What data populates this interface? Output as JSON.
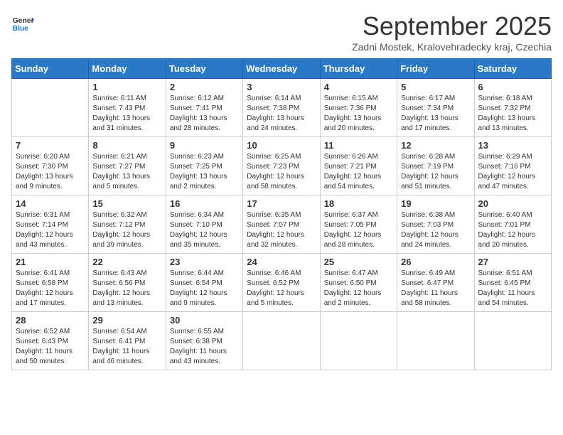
{
  "logo": {
    "general": "General",
    "blue": "Blue"
  },
  "title": "September 2025",
  "subtitle": "Zadni Mostek, Kralovehradecky kraj, Czechia",
  "weekdays": [
    "Sunday",
    "Monday",
    "Tuesday",
    "Wednesday",
    "Thursday",
    "Friday",
    "Saturday"
  ],
  "weeks": [
    [
      {
        "day": "",
        "sunrise": "",
        "sunset": "",
        "daylight": ""
      },
      {
        "day": "1",
        "sunrise": "Sunrise: 6:11 AM",
        "sunset": "Sunset: 7:43 PM",
        "daylight": "Daylight: 13 hours and 31 minutes."
      },
      {
        "day": "2",
        "sunrise": "Sunrise: 6:12 AM",
        "sunset": "Sunset: 7:41 PM",
        "daylight": "Daylight: 13 hours and 28 minutes."
      },
      {
        "day": "3",
        "sunrise": "Sunrise: 6:14 AM",
        "sunset": "Sunset: 7:38 PM",
        "daylight": "Daylight: 13 hours and 24 minutes."
      },
      {
        "day": "4",
        "sunrise": "Sunrise: 6:15 AM",
        "sunset": "Sunset: 7:36 PM",
        "daylight": "Daylight: 13 hours and 20 minutes."
      },
      {
        "day": "5",
        "sunrise": "Sunrise: 6:17 AM",
        "sunset": "Sunset: 7:34 PM",
        "daylight": "Daylight: 13 hours and 17 minutes."
      },
      {
        "day": "6",
        "sunrise": "Sunrise: 6:18 AM",
        "sunset": "Sunset: 7:32 PM",
        "daylight": "Daylight: 13 hours and 13 minutes."
      }
    ],
    [
      {
        "day": "7",
        "sunrise": "Sunrise: 6:20 AM",
        "sunset": "Sunset: 7:30 PM",
        "daylight": "Daylight: 13 hours and 9 minutes."
      },
      {
        "day": "8",
        "sunrise": "Sunrise: 6:21 AM",
        "sunset": "Sunset: 7:27 PM",
        "daylight": "Daylight: 13 hours and 5 minutes."
      },
      {
        "day": "9",
        "sunrise": "Sunrise: 6:23 AM",
        "sunset": "Sunset: 7:25 PM",
        "daylight": "Daylight: 13 hours and 2 minutes."
      },
      {
        "day": "10",
        "sunrise": "Sunrise: 6:25 AM",
        "sunset": "Sunset: 7:23 PM",
        "daylight": "Daylight: 12 hours and 58 minutes."
      },
      {
        "day": "11",
        "sunrise": "Sunrise: 6:26 AM",
        "sunset": "Sunset: 7:21 PM",
        "daylight": "Daylight: 12 hours and 54 minutes."
      },
      {
        "day": "12",
        "sunrise": "Sunrise: 6:28 AM",
        "sunset": "Sunset: 7:19 PM",
        "daylight": "Daylight: 12 hours and 51 minutes."
      },
      {
        "day": "13",
        "sunrise": "Sunrise: 6:29 AM",
        "sunset": "Sunset: 7:16 PM",
        "daylight": "Daylight: 12 hours and 47 minutes."
      }
    ],
    [
      {
        "day": "14",
        "sunrise": "Sunrise: 6:31 AM",
        "sunset": "Sunset: 7:14 PM",
        "daylight": "Daylight: 12 hours and 43 minutes."
      },
      {
        "day": "15",
        "sunrise": "Sunrise: 6:32 AM",
        "sunset": "Sunset: 7:12 PM",
        "daylight": "Daylight: 12 hours and 39 minutes."
      },
      {
        "day": "16",
        "sunrise": "Sunrise: 6:34 AM",
        "sunset": "Sunset: 7:10 PM",
        "daylight": "Daylight: 12 hours and 35 minutes."
      },
      {
        "day": "17",
        "sunrise": "Sunrise: 6:35 AM",
        "sunset": "Sunset: 7:07 PM",
        "daylight": "Daylight: 12 hours and 32 minutes."
      },
      {
        "day": "18",
        "sunrise": "Sunrise: 6:37 AM",
        "sunset": "Sunset: 7:05 PM",
        "daylight": "Daylight: 12 hours and 28 minutes."
      },
      {
        "day": "19",
        "sunrise": "Sunrise: 6:38 AM",
        "sunset": "Sunset: 7:03 PM",
        "daylight": "Daylight: 12 hours and 24 minutes."
      },
      {
        "day": "20",
        "sunrise": "Sunrise: 6:40 AM",
        "sunset": "Sunset: 7:01 PM",
        "daylight": "Daylight: 12 hours and 20 minutes."
      }
    ],
    [
      {
        "day": "21",
        "sunrise": "Sunrise: 6:41 AM",
        "sunset": "Sunset: 6:58 PM",
        "daylight": "Daylight: 12 hours and 17 minutes."
      },
      {
        "day": "22",
        "sunrise": "Sunrise: 6:43 AM",
        "sunset": "Sunset: 6:56 PM",
        "daylight": "Daylight: 12 hours and 13 minutes."
      },
      {
        "day": "23",
        "sunrise": "Sunrise: 6:44 AM",
        "sunset": "Sunset: 6:54 PM",
        "daylight": "Daylight: 12 hours and 9 minutes."
      },
      {
        "day": "24",
        "sunrise": "Sunrise: 6:46 AM",
        "sunset": "Sunset: 6:52 PM",
        "daylight": "Daylight: 12 hours and 5 minutes."
      },
      {
        "day": "25",
        "sunrise": "Sunrise: 6:47 AM",
        "sunset": "Sunset: 6:50 PM",
        "daylight": "Daylight: 12 hours and 2 minutes."
      },
      {
        "day": "26",
        "sunrise": "Sunrise: 6:49 AM",
        "sunset": "Sunset: 6:47 PM",
        "daylight": "Daylight: 11 hours and 58 minutes."
      },
      {
        "day": "27",
        "sunrise": "Sunrise: 6:51 AM",
        "sunset": "Sunset: 6:45 PM",
        "daylight": "Daylight: 11 hours and 54 minutes."
      }
    ],
    [
      {
        "day": "28",
        "sunrise": "Sunrise: 6:52 AM",
        "sunset": "Sunset: 6:43 PM",
        "daylight": "Daylight: 11 hours and 50 minutes."
      },
      {
        "day": "29",
        "sunrise": "Sunrise: 6:54 AM",
        "sunset": "Sunset: 6:41 PM",
        "daylight": "Daylight: 11 hours and 46 minutes."
      },
      {
        "day": "30",
        "sunrise": "Sunrise: 6:55 AM",
        "sunset": "Sunset: 6:38 PM",
        "daylight": "Daylight: 11 hours and 43 minutes."
      },
      {
        "day": "",
        "sunrise": "",
        "sunset": "",
        "daylight": ""
      },
      {
        "day": "",
        "sunrise": "",
        "sunset": "",
        "daylight": ""
      },
      {
        "day": "",
        "sunrise": "",
        "sunset": "",
        "daylight": ""
      },
      {
        "day": "",
        "sunrise": "",
        "sunset": "",
        "daylight": ""
      }
    ]
  ]
}
